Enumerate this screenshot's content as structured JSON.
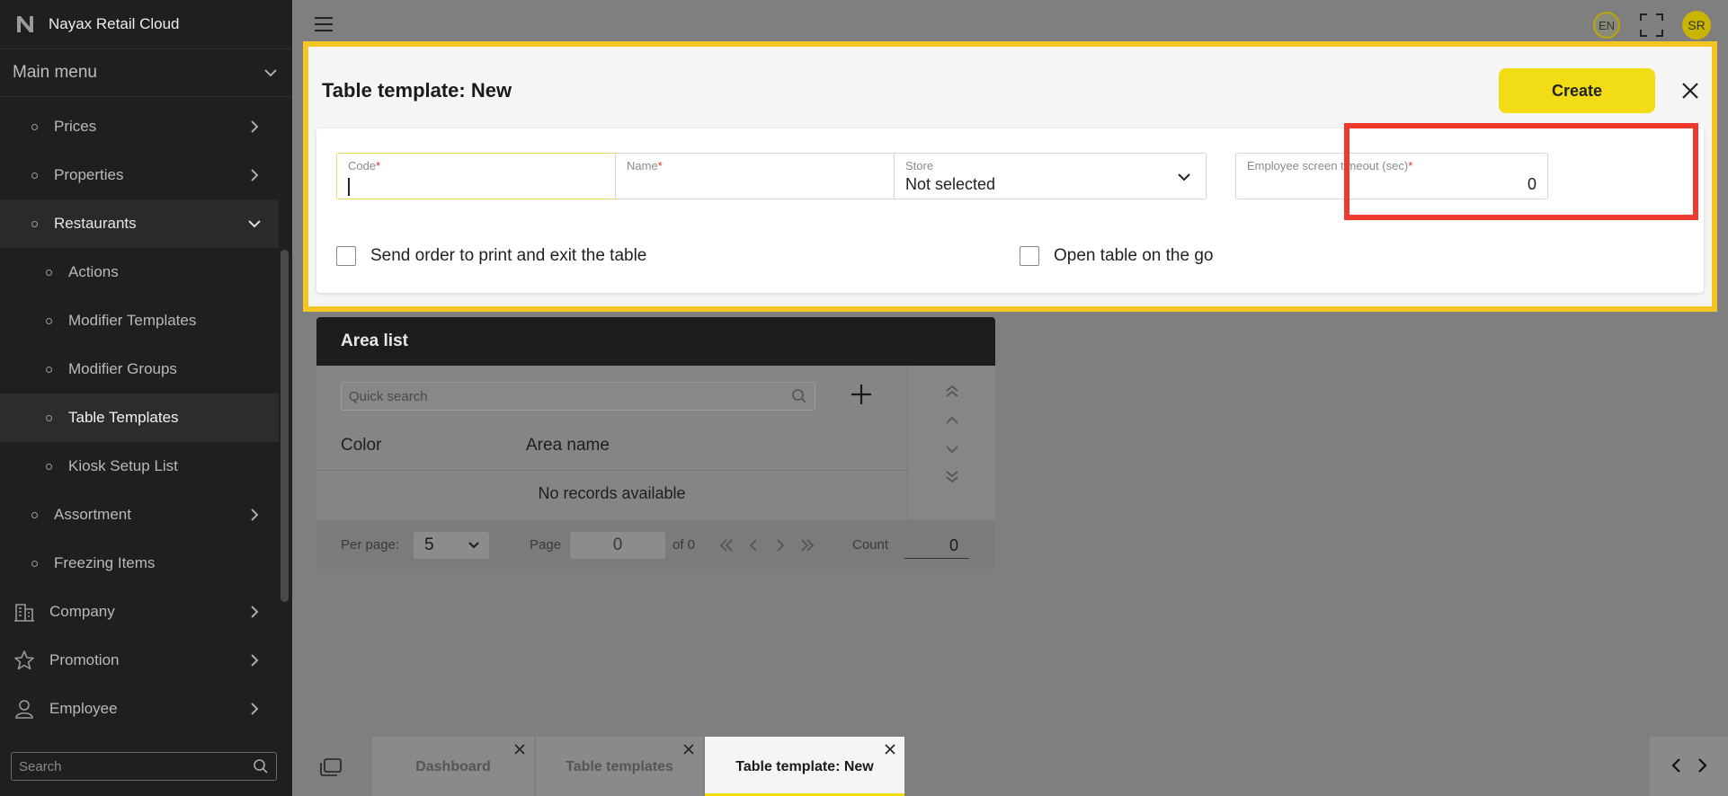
{
  "app": {
    "title": "Nayax Retail Cloud"
  },
  "sidebar": {
    "main_menu": "Main menu",
    "items": [
      {
        "label": "Prices"
      },
      {
        "label": "Properties"
      },
      {
        "label": "Restaurants"
      },
      {
        "label": "Actions"
      },
      {
        "label": "Modifier Templates"
      },
      {
        "label": "Modifier Groups"
      },
      {
        "label": "Table Templates"
      },
      {
        "label": "Kiosk Setup List"
      },
      {
        "label": "Assortment"
      },
      {
        "label": "Freezing Items"
      },
      {
        "label": "Company"
      },
      {
        "label": "Promotion"
      },
      {
        "label": "Employee"
      }
    ],
    "search_placeholder": "Search"
  },
  "header": {
    "language": "EN",
    "avatar_initials": "SR"
  },
  "modal": {
    "title": "Table template: New",
    "create_label": "Create",
    "fields": {
      "code": {
        "label": "Code",
        "value": ""
      },
      "name": {
        "label": "Name",
        "value": ""
      },
      "store": {
        "label": "Store",
        "value": "Not selected"
      },
      "timeout": {
        "label": "Employee screen timeout (sec)",
        "value": "0"
      }
    },
    "required_mark": "*",
    "checkboxes": {
      "send_order": "Send order to print and exit the table",
      "open_on_go": "Open table on the go"
    }
  },
  "area_list": {
    "title": "Area list",
    "search_placeholder": "Quick search",
    "columns": [
      "Color",
      "Area name"
    ],
    "empty_text": "No records available",
    "footer": {
      "per_page_label": "Per page:",
      "per_page_value": "5",
      "page_label": "Page",
      "page_value": "0",
      "of_label": "of 0",
      "count_label": "Count",
      "count_value": "0"
    }
  },
  "tabs": [
    {
      "label": "Dashboard"
    },
    {
      "label": "Table templates"
    },
    {
      "label": "Table template: New"
    }
  ],
  "colors": {
    "accent": "#f2dc16",
    "highlight_frame": "#f3c623",
    "annotation": "#ee3a2e",
    "sidebar_bg": "#1f1f1f"
  }
}
